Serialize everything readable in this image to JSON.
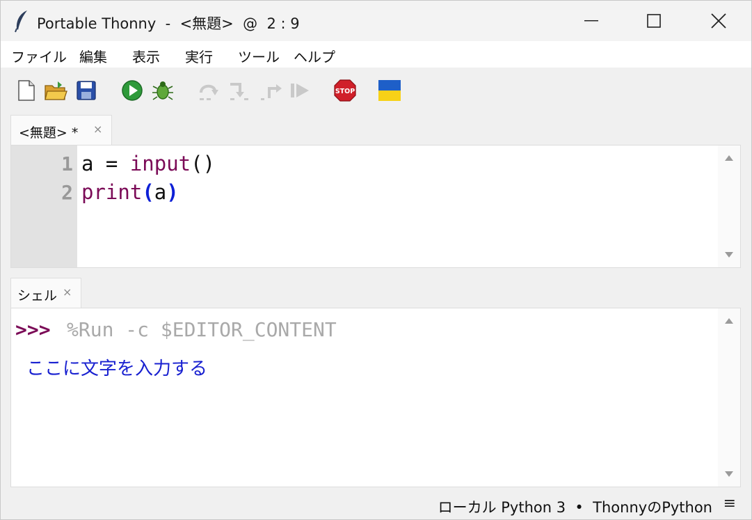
{
  "window": {
    "title": "Portable Thonny  -  <無題>  @  2 : 9"
  },
  "menubar": {
    "items": [
      "ファイル",
      "編集",
      "表示",
      "実行",
      "ツール",
      "ヘルプ"
    ]
  },
  "toolbar": {
    "icons": [
      "new-file-icon",
      "open-folder-icon",
      "save-icon",
      "run-icon",
      "debug-bug-icon",
      "step-over-icon",
      "step-into-icon",
      "step-out-icon",
      "resume-icon",
      "stop-icon",
      "ukraine-flag-icon"
    ],
    "stop_label": "STOP"
  },
  "editor": {
    "tab_label": "<無題> *",
    "tab_close": "×",
    "line_numbers": [
      "1",
      "2"
    ],
    "lines": [
      {
        "a": "a = ",
        "b": "input",
        "c": "()"
      },
      {
        "a": "print",
        "b": "(",
        "c": "a",
        "d": ")"
      }
    ]
  },
  "shell": {
    "tab_label": "シェル",
    "tab_close": "×",
    "prompt": ">>>",
    "command": "%Run -c $EDITOR_CONTENT",
    "input_text": "ここに文字を入力する"
  },
  "statusbar": {
    "text": "ローカル Python 3  •  ThonnyのPython",
    "menu_glyph": "≡"
  },
  "colors": {
    "keyword": "#7b0b57",
    "paren_match": "#0e20d6",
    "stdin": "#1820d0",
    "command": "#a9a9a9"
  }
}
